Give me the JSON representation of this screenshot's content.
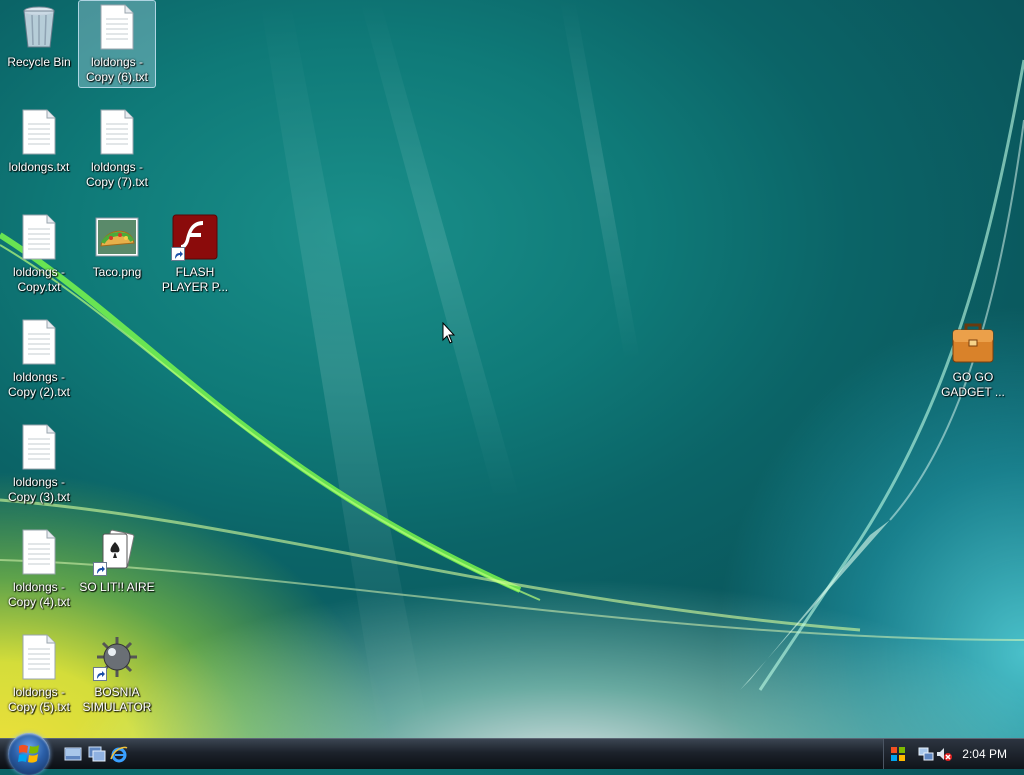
{
  "desktop": {
    "icons": [
      {
        "label": "Recycle Bin",
        "type": "recycle"
      },
      {
        "label": "loldongs - Copy (6).txt",
        "type": "text"
      },
      {
        "label": "loldongs.txt",
        "type": "text"
      },
      {
        "label": "loldongs - Copy (7).txt",
        "type": "text"
      },
      {
        "label": "loldongs - Copy.txt",
        "type": "text"
      },
      {
        "label": "Taco.png",
        "type": "image"
      },
      {
        "label": "FLASH PLAYER P...",
        "type": "flash-shortcut"
      },
      {
        "label": "loldongs - Copy (2).txt",
        "type": "text"
      },
      {
        "label": "loldongs - Copy (3).txt",
        "type": "text"
      },
      {
        "label": "loldongs - Copy (4).txt",
        "type": "text"
      },
      {
        "label": "SO LIT!! AIRE",
        "type": "solitaire-shortcut"
      },
      {
        "label": "loldongs - Copy (5).txt",
        "type": "text"
      },
      {
        "label": "BOSNIA SIMULATOR",
        "type": "minesweeper-shortcut"
      },
      {
        "label": "GO GO GADGET ...",
        "type": "briefcase"
      }
    ]
  },
  "taskbar": {
    "clock": "2:04 PM",
    "quick_launch": [
      "show-desktop-icon",
      "switch-windows-icon",
      "internet-explorer-icon"
    ],
    "tray": [
      "windows-flag-icon",
      "network-icon",
      "volume-muted-icon"
    ]
  },
  "colors": {
    "taskbar": "#1c222b",
    "selection": "#bee1f0",
    "flash_red": "#8b0b0b"
  }
}
